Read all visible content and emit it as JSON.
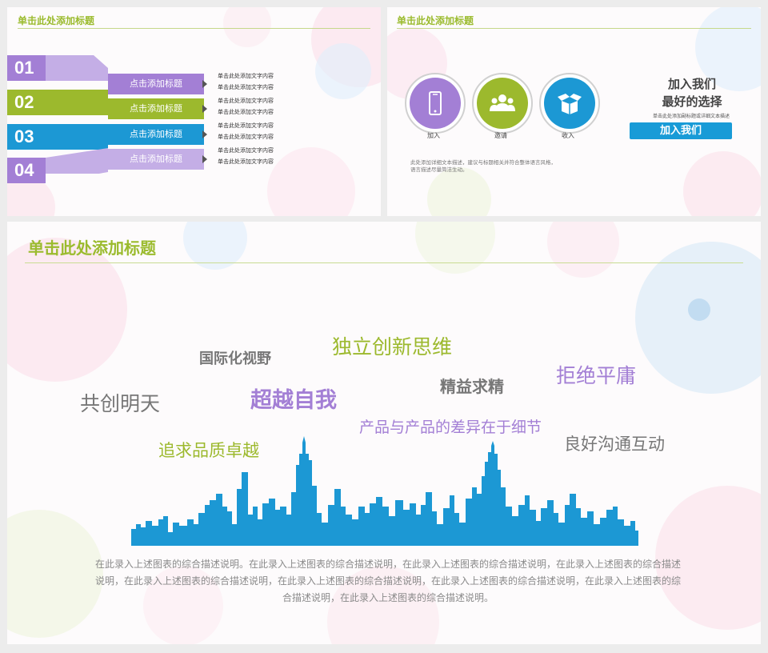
{
  "slide1": {
    "title": "单击此处添加标题",
    "items": [
      {
        "num": "01",
        "label": "点击添加标题",
        "lines": [
          "单击此处添加文字内容",
          "单击此处添加文字内容"
        ],
        "color": "#a37fd5"
      },
      {
        "num": "02",
        "label": "点击添加标题",
        "lines": [
          "单击此处添加文字内容",
          "单击此处添加文字内容"
        ],
        "color": "#9cb92d"
      },
      {
        "num": "03",
        "label": "点击添加标题",
        "lines": [
          "单击此处添加文字内容",
          "单击此处添加文字内容"
        ],
        "color": "#1c98d4"
      },
      {
        "num": "04",
        "label": "点击添加标题",
        "lines": [
          "单击此处添加文字内容",
          "单击此处添加文字内容"
        ],
        "color": "#a37fd5"
      }
    ]
  },
  "slide2": {
    "title": "单击此处添加标题",
    "circles": [
      {
        "label": "加入",
        "icon": "phone-icon",
        "color": "#a37fd5"
      },
      {
        "label": "邀请",
        "icon": "people-icon",
        "color": "#9cb92d"
      },
      {
        "label": "收入",
        "icon": "box-icon",
        "color": "#1c98d4"
      }
    ],
    "heading_line1": "加入我们",
    "heading_line2": "最好的选择",
    "subtitle": "单击此处添加副标题或详细文本描述",
    "button_label": "加入我们",
    "desc_line1": "此处添加详细文本描述，建议与标题相关并符合整体语言风格，",
    "desc_line2": "语言描述尽量简洁生动。"
  },
  "slide3": {
    "title": "单击此处添加标题",
    "words": [
      {
        "text": "独立创新思维",
        "color": "#9cb92d"
      },
      {
        "text": "国际化视野",
        "color": "#777777"
      },
      {
        "text": "拒绝平庸",
        "color": "#a37fd5"
      },
      {
        "text": "精益求精",
        "color": "#777777"
      },
      {
        "text": "共创明天",
        "color": "#777777"
      },
      {
        "text": "超越自我",
        "color": "#a37fd5"
      },
      {
        "text": "产品与产品的差异在于细节",
        "color": "#a37fd5"
      },
      {
        "text": "良好沟通互动",
        "color": "#777777"
      },
      {
        "text": "追求品质卓越",
        "color": "#9cb92d"
      }
    ],
    "skyline_color": "#1c98d4",
    "description": "在此录入上述图表的综合描述说明。在此录入上述图表的综合描述说明，在此录入上述图表的综合描述说明，在此录入上述图表的综合描述说明，在此录入上述图表的综合描述说明，在此录入上述图表的综合描述说明，在此录入上述图表的综合描述说明，在此录入上述图表的综合描述说明，在此录入上述图表的综合描述说明。"
  }
}
